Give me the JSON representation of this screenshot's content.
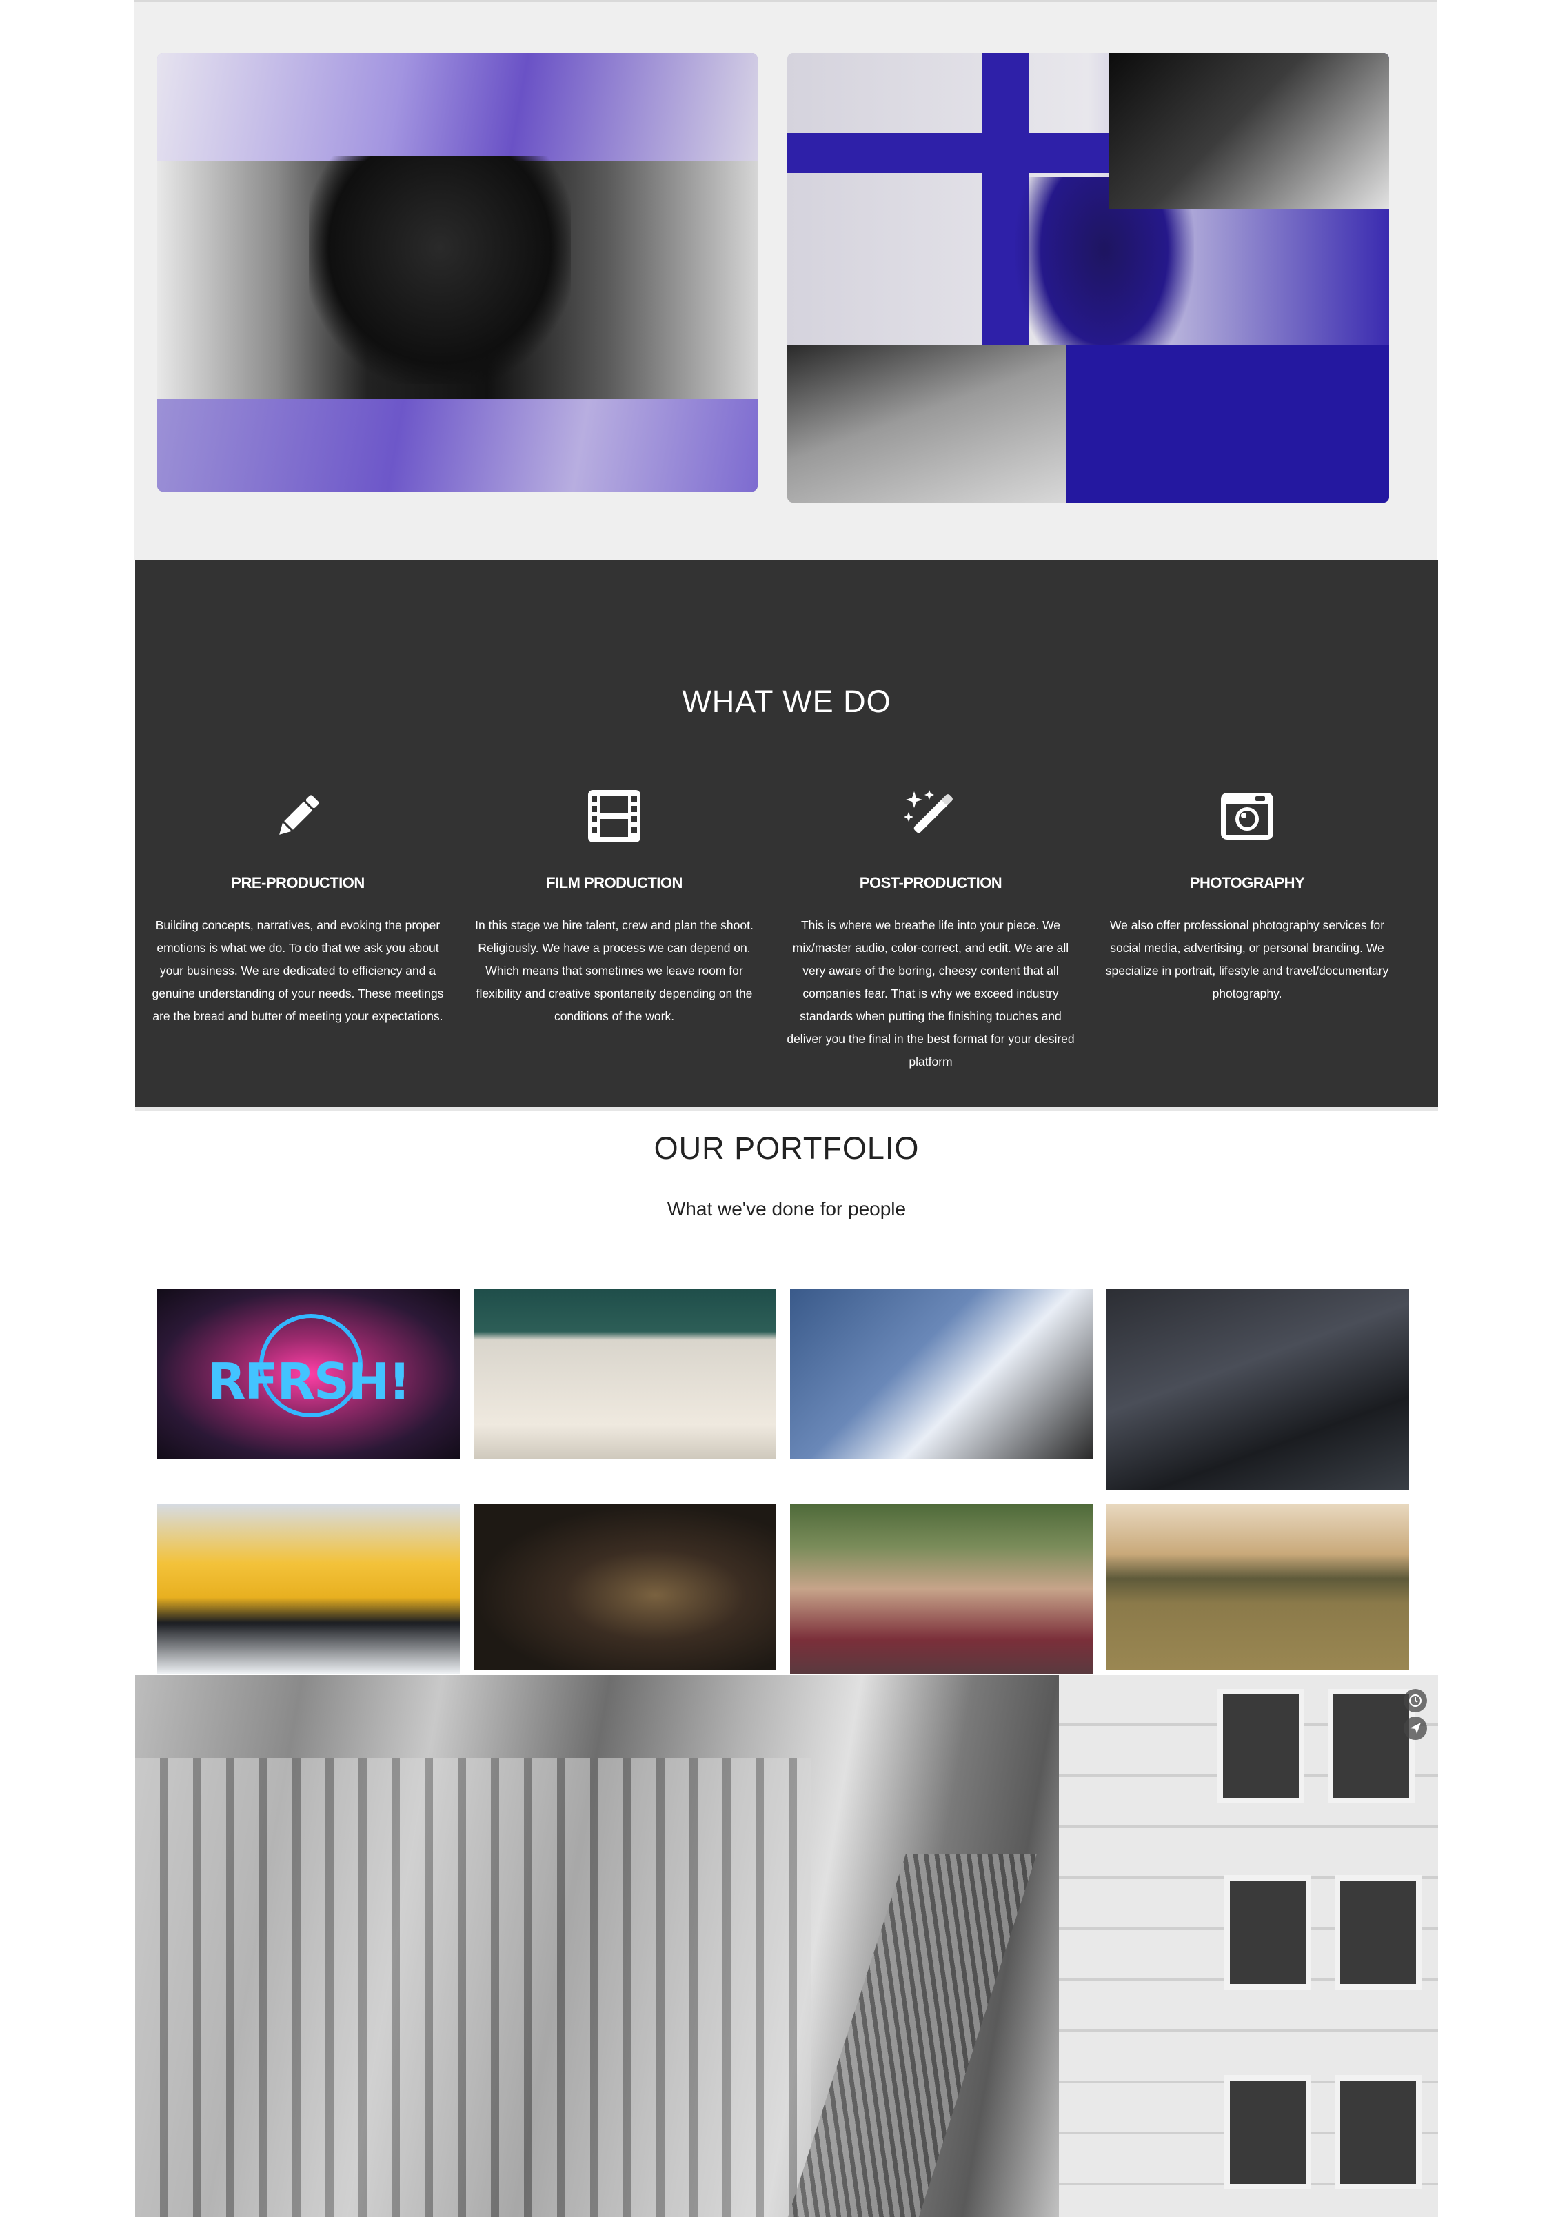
{
  "services": {
    "title": "WHAT WE DO",
    "items": [
      {
        "icon": "pencil-icon",
        "heading": "PRE-PRODUCTION",
        "description": "Building concepts, narratives, and evoking the proper emotions is what we do. To do that we ask you about your business. We are dedicated to efficiency and a genuine understanding of your needs. These meetings are the bread and butter of meeting your expectations."
      },
      {
        "icon": "film-icon",
        "heading": "FILM PRODUCTION",
        "description": "In this stage we hire talent, crew and plan the shoot. Religiously. We have a process we can depend on. Which means that sometimes we leave room for flexibility and creative spontaneity depending on the conditions of the work."
      },
      {
        "icon": "magic-wand-icon",
        "heading": "POST-PRODUCTION",
        "description": "This is where we breathe life into your piece. We mix/master audio, color-correct, and edit. We are all very aware of the boring, cheesy content that all companies fear. That is why we exceed industry standards when putting the finishing touches and deliver you the final in the best format for your desired platform"
      },
      {
        "icon": "camera-icon",
        "heading": "PHOTOGRAPHY",
        "description": "We also offer professional photography services for social media, advertising, or personal branding. We specialize in portrait, lifestyle and travel/documentary photography."
      }
    ]
  },
  "portfolio": {
    "title": "OUR PORTFOLIO",
    "subtitle": "What we've done for people",
    "thumbnails": [
      {
        "overlay_text": "RFRSH!"
      },
      {},
      {},
      {},
      {},
      {},
      {},
      {}
    ]
  },
  "hero": {
    "icons": [
      "clock-icon",
      "send-icon"
    ]
  },
  "colors": {
    "services_bg": "#333333",
    "gallery_bg": "#efefef",
    "accent_blue": "#2e20a8",
    "rfrsh_blue": "#43c3ff"
  }
}
